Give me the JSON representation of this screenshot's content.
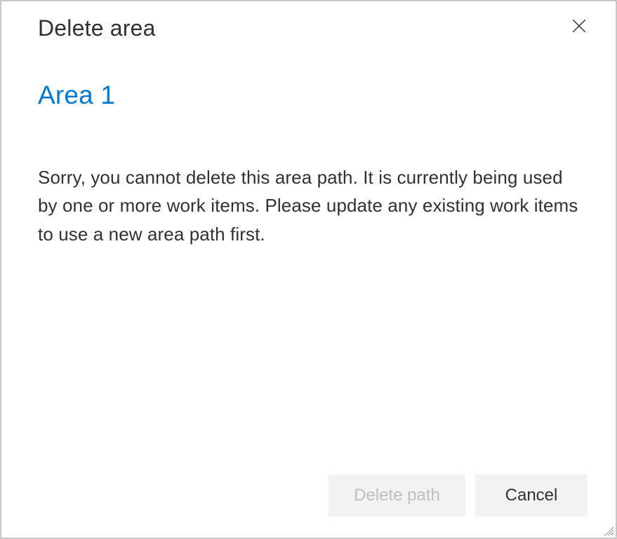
{
  "dialog": {
    "title": "Delete area",
    "area_name": "Area 1",
    "message": "Sorry, you cannot delete this area path. It is currently being used by one or more work items. Please update any existing work items to use a new area path first."
  },
  "buttons": {
    "delete_label": "Delete path",
    "cancel_label": "Cancel"
  }
}
